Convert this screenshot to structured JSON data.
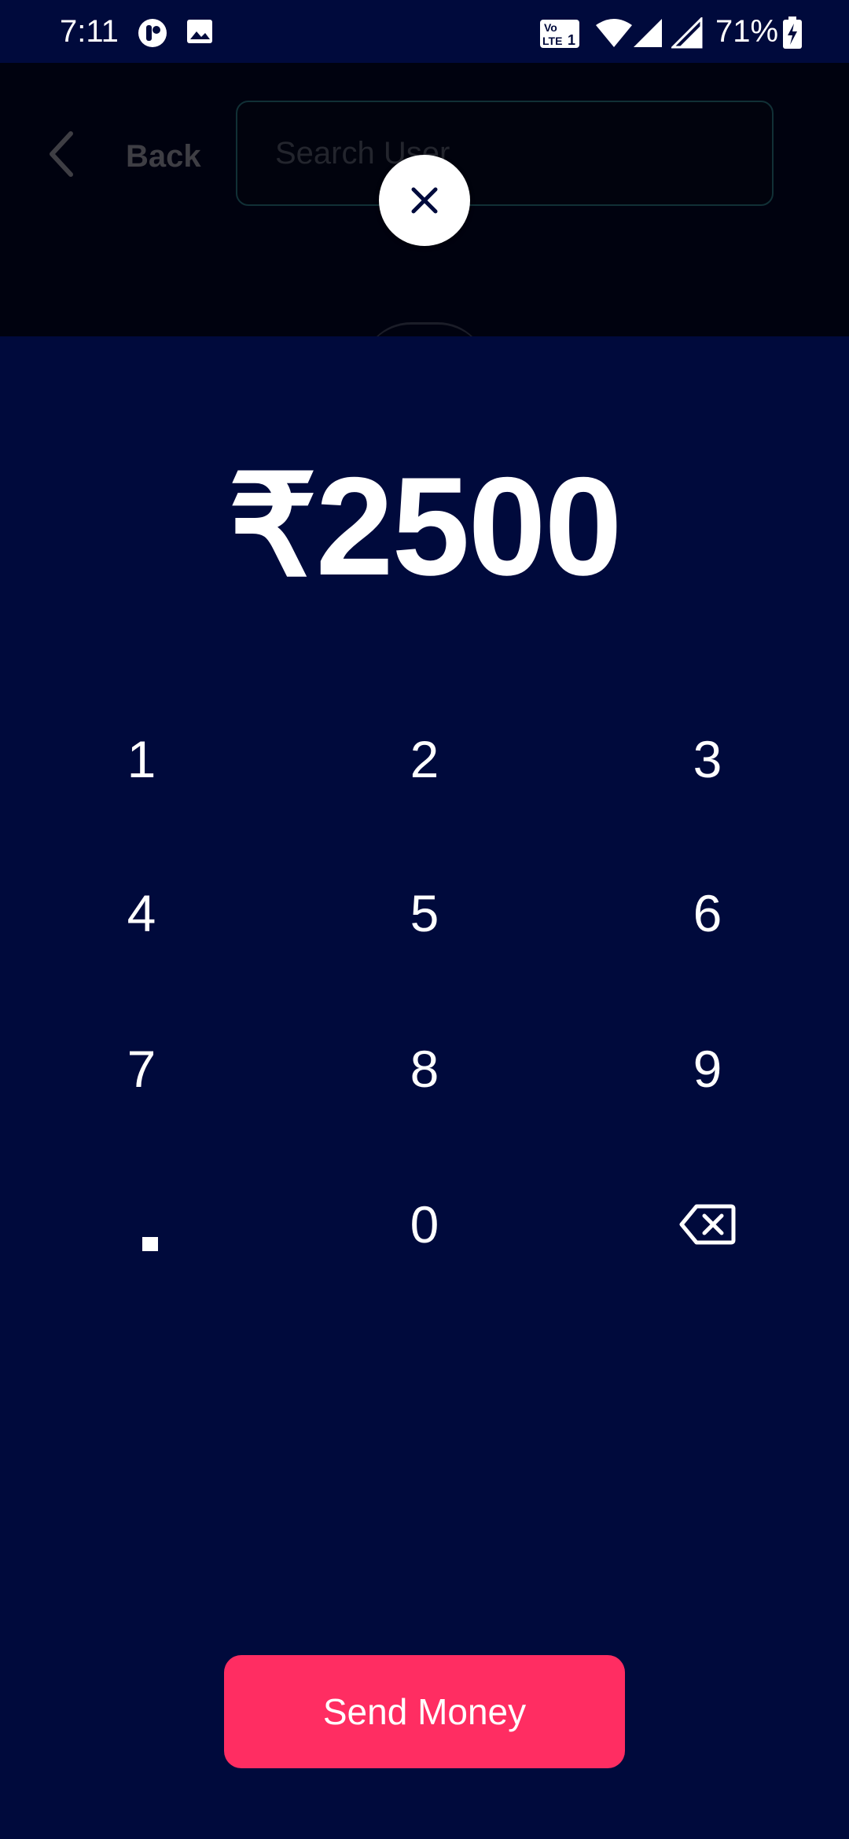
{
  "status_bar": {
    "time": "7:11",
    "battery_percent": "71%",
    "icons": [
      "app-notification-icon",
      "gallery-icon",
      "volte-icon",
      "wifi-icon",
      "signal-icon",
      "signal-icon",
      "battery-charging-icon"
    ]
  },
  "backdrop": {
    "back_label": "Back",
    "search_placeholder": "Search User"
  },
  "amount": {
    "display": "₹2500"
  },
  "keypad": {
    "k1": "1",
    "k2": "2",
    "k3": "3",
    "k4": "4",
    "k5": "5",
    "k6": "6",
    "k7": "7",
    "k8": "8",
    "k9": "9",
    "k0": "0",
    "decimal_icon": "decimal-point-icon",
    "backspace_icon": "backspace-icon"
  },
  "actions": {
    "send_label": "Send Money"
  },
  "colors": {
    "background": "#000a3c",
    "accent": "#ff2d62",
    "text": "#ffffff"
  }
}
